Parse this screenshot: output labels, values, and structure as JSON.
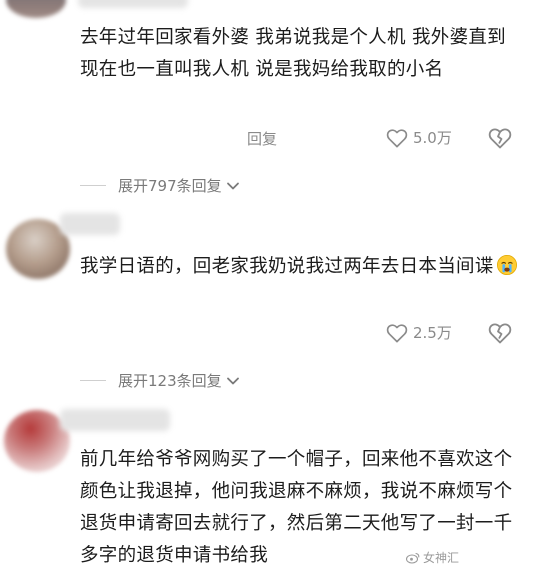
{
  "comments": [
    {
      "text": "去年过年回家看外婆 我弟说我是个人机 我外婆直到现在也一直叫我人机 说是我妈给我取的小名",
      "reply_label": "回复",
      "likes": "5.0万",
      "expand_label": "展开797条回复"
    },
    {
      "text": "我学日语的，回老家我奶说我过两年去日本当间谍",
      "reply_label": "",
      "likes": "2.5万",
      "expand_label": "展开123条回复"
    },
    {
      "text": "前几年给爷爷网购买了一个帽子，回来他不喜欢这个颜色让我退掉，他问我退麻不麻烦，我说不麻烦写个退货申请寄回去就行了，然后第二天他写了一封一千多字的退货申请书给我"
    }
  ],
  "icons": {
    "like": "heart-outline-icon",
    "dislike": "broken-heart-icon",
    "expand": "chevron-down-icon",
    "emoji": "crying-face-emoji",
    "watermark_logo": "weibo-logo-icon"
  },
  "watermark": {
    "text": "女神汇"
  }
}
